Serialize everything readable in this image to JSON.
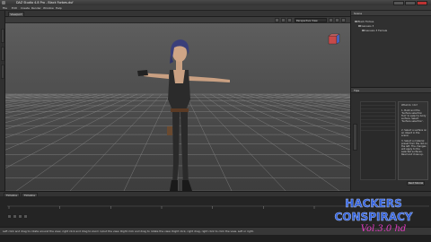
{
  "window": {
    "title": "DAZ Studio 4.8 Pro - Black Forbes.duf"
  },
  "menubar": {
    "items": [
      "File",
      "Edit",
      "Create",
      "Render",
      "Window",
      "Help"
    ]
  },
  "viewport": {
    "tab_label": "Viewport",
    "camera_label": "Perspective View",
    "grid_visible": true
  },
  "scene_pane": {
    "tab_label": "Scene",
    "rows": [
      "Black Forbes",
      "Genesis 3",
      "Genesis 3 Female"
    ]
  },
  "tips_pane": {
    "tab_label": "Tips",
    "text_1": "What do I do?",
    "text_2": "1. Build and the 'Surface selection Tool' to select a body surface. Select 'Surface selection'.",
    "text_3": "2. Select a surface on an object in the scene.",
    "text_4": "3. Select a material preset from the list on the left. The changes will apply to the selected surfaces. Read and close up.",
    "next_label": "Next Tutorial"
  },
  "timeline": {
    "tabs": [
      "Timeline",
      "Timeline"
    ],
    "frames": [
      0,
      5,
      10,
      15,
      20,
      25,
      30
    ]
  },
  "statusbar": {
    "text": "Left click and drag to rotate around the view, right click and drag to zoom in/out the view. Right click and drag to rotate the view; Right click, right drag, right click to click the view. Left or right."
  },
  "watermark": {
    "line1": "HACKERS",
    "line2": "CONSPIRACY",
    "line3": "Vol.3.0 hd"
  },
  "colors": {
    "accent": "#e03cc0",
    "logo_blue": "#2f5dd8",
    "grid": "#8a8a8a"
  }
}
